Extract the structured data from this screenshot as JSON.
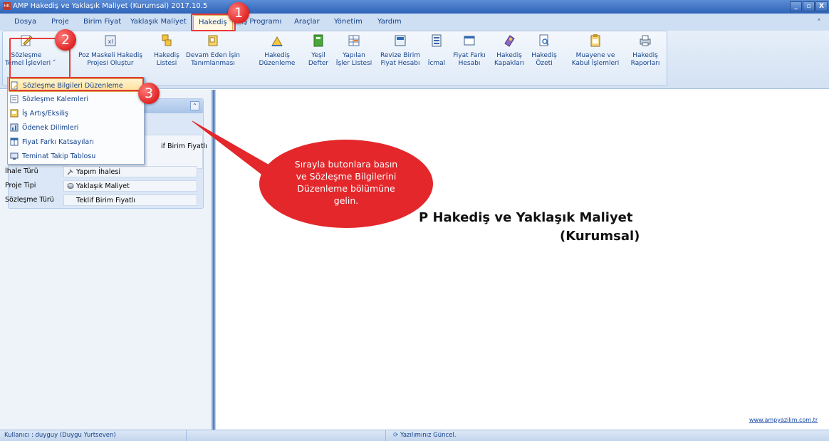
{
  "window": {
    "title": "AMP Hakediş ve Yaklaşık Maliyet (Kurumsal) 2017.10.5",
    "buttons": [
      "_",
      "▫",
      "X"
    ]
  },
  "menu": {
    "tabs": [
      {
        "label": "Dosya"
      },
      {
        "label": "Proje"
      },
      {
        "label": "Birim Fiyat"
      },
      {
        "label": "Yaklaşık Maliyet"
      },
      {
        "label": "Hakediş"
      },
      {
        "label": "İş Programı"
      },
      {
        "label": "Araçlar"
      },
      {
        "label": "Yönetim"
      },
      {
        "label": "Yardım"
      }
    ],
    "active_tab": "Hakediş",
    "pin_glyph": "ᶺ"
  },
  "ribbon": {
    "buttons": [
      {
        "line1": "Sözleşme",
        "line2": "Temel İşlevleri ˅",
        "icon": "contract-edit-icon"
      },
      {
        "line1": "Poz Maskeli Hakediş",
        "line2": "Projesi Oluştur",
        "icon": "excel-icon"
      },
      {
        "line1": "Hakediş",
        "line2": "Listesi",
        "icon": "list-icon"
      },
      {
        "line1": "Devam Eden İşin",
        "line2": "Tanımlanması",
        "icon": "work-define-icon"
      },
      {
        "line1": "Hakediş",
        "line2": "Düzenleme",
        "icon": "ruler-icon"
      },
      {
        "line1": "Yeşil",
        "line2": "Defter",
        "icon": "green-book-icon"
      },
      {
        "line1": "Yapılan",
        "line2": "İşler Listesi",
        "icon": "table-icon"
      },
      {
        "line1": "Revize Birim",
        "line2": "Fiyat Hesabı",
        "icon": "calculator-icon"
      },
      {
        "line1": "",
        "line2": "İcmal",
        "icon": "summary-icon"
      },
      {
        "line1": "Fiyat Farkı",
        "line2": "Hesabı",
        "icon": "price-diff-icon"
      },
      {
        "line1": "Hakediş",
        "line2": "Kapakları",
        "icon": "cover-icon"
      },
      {
        "line1": "Hakediş",
        "line2": "Özeti",
        "icon": "search-doc-icon"
      },
      {
        "line1": "Muayene ve",
        "line2": "Kabul İşlemleri",
        "icon": "clipboard-icon"
      },
      {
        "line1": "Hakediş",
        "line2": "Raporları",
        "icon": "printer-icon"
      }
    ]
  },
  "dropdown": {
    "items": [
      {
        "label": "Sözleşme Bilgileri Düzenleme",
        "icon": "edit-doc-icon"
      },
      {
        "label": "Sözleşme Kalemleri",
        "icon": "doc-lines-icon"
      },
      {
        "label": "İş Artış/Eksiliş",
        "icon": "increase-icon"
      },
      {
        "label": "Ödenek Dilimleri",
        "icon": "bars-icon"
      },
      {
        "label": "Fiyat Farkı Katsayıları",
        "icon": "grid-icon"
      },
      {
        "label": "Teminat Takip Tablosu",
        "icon": "monitor-icon"
      }
    ]
  },
  "left_panel": {
    "partial_value": "if Birim Fiyatlı",
    "rows": [
      {
        "label": "İhale Türü",
        "value": "Yapım İhalesi",
        "icon": "tools-icon"
      },
      {
        "label": "Proje Tipi",
        "value": "Yaklaşık Maliyet",
        "icon": "coins-icon"
      },
      {
        "label": "Sözleşme Türü",
        "value": "Teklif Birim Fiyatlı",
        "icon": ""
      }
    ]
  },
  "main": {
    "title_line1": "P Hakediş ve Yaklaşık Maliyet",
    "title_line2": "(Kurumsal)",
    "website": "www.ampyazilim.com.tr"
  },
  "status": {
    "user": "Kullanıcı : duyguy  (Duygu Yurtseven)",
    "update": "Yazılımınız Güncel."
  },
  "annotations": {
    "badges": [
      "1",
      "2",
      "3"
    ],
    "callout_lines": [
      "Sırayla butonlara basın",
      "ve Sözleşme Bilgilerini",
      "Düzenleme bölümüne",
      "gelin."
    ],
    "color": "#e53b3b"
  }
}
